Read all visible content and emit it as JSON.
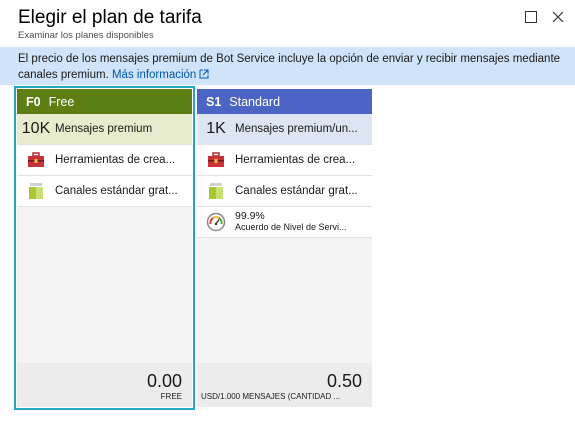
{
  "blade": {
    "title": "Elegir el plan de tarifa",
    "subtitle": "Examinar los planes disponibles"
  },
  "banner": {
    "text": "El precio de los mensajes premium de Bot Service incluye la opción de enviar y recibir mensajes mediante canales premium.",
    "link_label": "Más información"
  },
  "plans": [
    {
      "code": "F0",
      "name": "Free",
      "header_color": "#5c7e13",
      "selected": true,
      "quota_value": "10K",
      "quota_label": "Mensajes premium",
      "tools_label": "Herramientas de crea...",
      "channels_label": "Canales estándar grat...",
      "price": "0.00",
      "price_unit": "FREE"
    },
    {
      "code": "S1",
      "name": "Standard",
      "header_color": "#4c64c3",
      "selected": false,
      "quota_value": "1K",
      "quota_label": "Mensajes premium/un...",
      "tools_label": "Herramientas de crea...",
      "channels_label": "Canales estándar grat...",
      "sla_value": "99.9%",
      "sla_label": "Acuerdo de Nivel de Servi...",
      "price": "0.50",
      "price_unit": "USD/1.000 MENSAJES (CANTIDAD ..."
    }
  ],
  "colors": {
    "selection_border": "#24a5c4",
    "banner_bg": "#cfe3f9",
    "link": "#0058ad"
  },
  "icons": [
    "maximize-icon",
    "close-icon",
    "external-link-icon",
    "toolbox-icon",
    "channels-icon",
    "gauge-icon"
  ]
}
